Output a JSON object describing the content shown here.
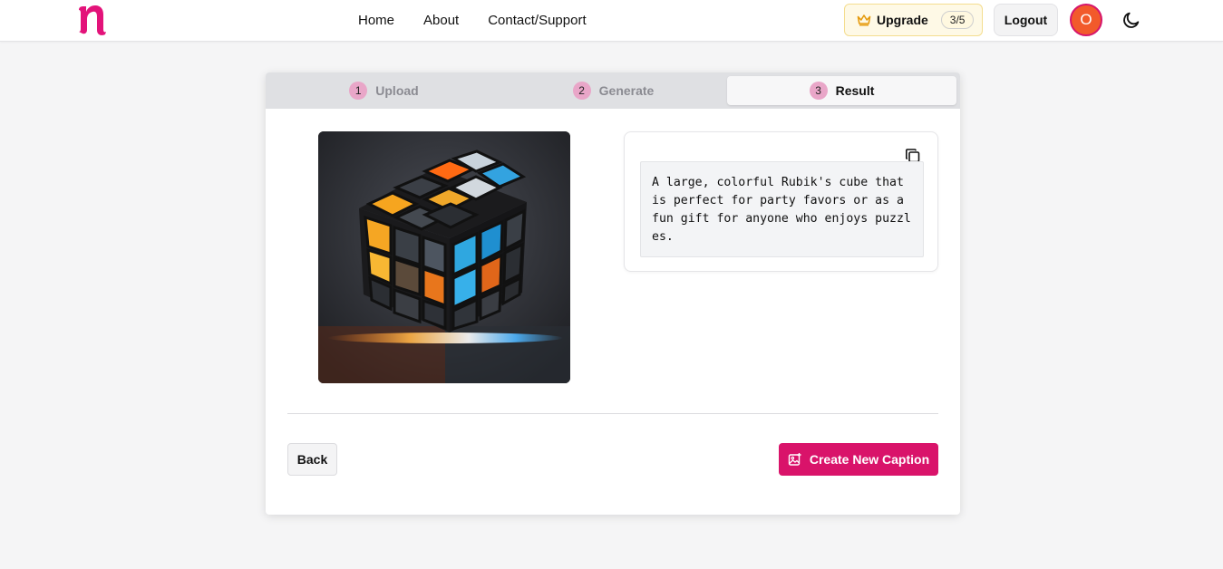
{
  "header": {
    "logo_text": "n",
    "logo_icon": "brand-n-logo",
    "nav": [
      {
        "label": "Home"
      },
      {
        "label": "About"
      },
      {
        "label": "Contact/Support"
      }
    ],
    "upgrade": {
      "label": "Upgrade",
      "count": "3/5",
      "icon": "crown-icon"
    },
    "logout_label": "Logout",
    "avatar_initial": "O",
    "theme_icon": "moon-icon"
  },
  "stepper": {
    "steps": [
      {
        "number": "1",
        "label": "Upload",
        "active": false
      },
      {
        "number": "2",
        "label": "Generate",
        "active": false
      },
      {
        "number": "3",
        "label": "Result",
        "active": true
      }
    ]
  },
  "result": {
    "image_subject": "rubiks-cube-image",
    "caption": "A large, colorful Rubik's cube that is perfect for party favors or as a fun gift for anyone who enjoys puzzles.",
    "copy_icon": "copy-icon"
  },
  "actions": {
    "back_label": "Back",
    "create_label": "Create New Caption",
    "create_icon": "image-plus-icon"
  },
  "colors": {
    "brand": "#d9136a",
    "avatar_bg": "#f25a2b",
    "step_badge": "#e9a6c8",
    "upgrade_bg": "#fef9e6"
  }
}
